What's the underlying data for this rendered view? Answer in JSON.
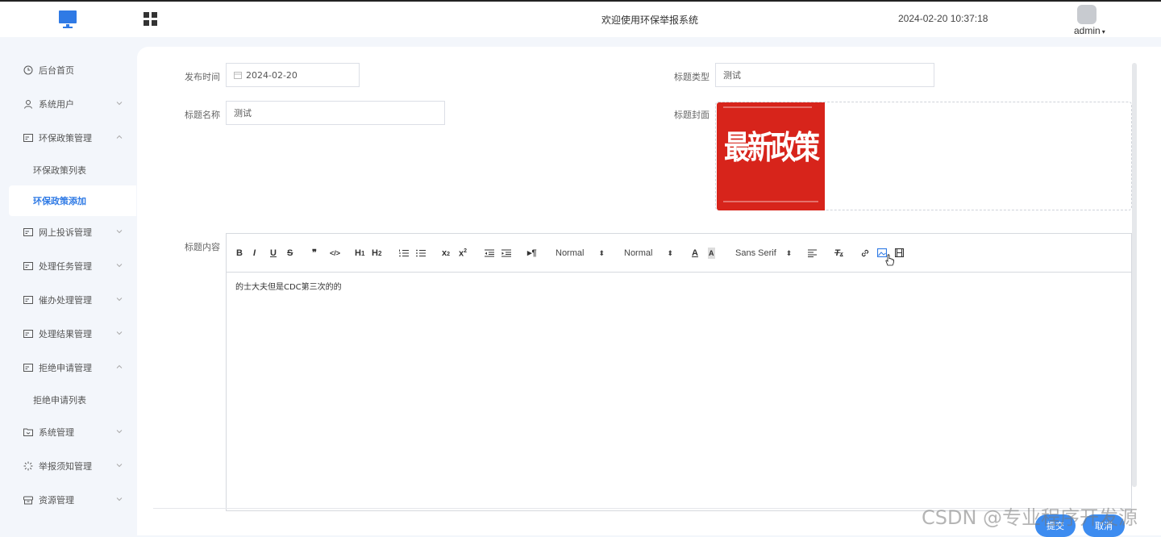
{
  "header": {
    "title": "欢迎使用环保举报系统",
    "datetime": "2024-02-20 10:37:18",
    "user": "admin"
  },
  "sidebar": {
    "items": [
      {
        "label": "后台首页",
        "icon": "clock-icon"
      },
      {
        "label": "系统用户",
        "icon": "user-icon",
        "chevron": "down"
      },
      {
        "label": "环保政策管理",
        "icon": "card-icon",
        "chevron": "up"
      },
      {
        "label": "环保政策列表"
      },
      {
        "label": "环保政策添加",
        "active": true
      },
      {
        "label": "网上投诉管理",
        "icon": "card-icon",
        "chevron": "down"
      },
      {
        "label": "处理任务管理",
        "icon": "card-icon",
        "chevron": "down"
      },
      {
        "label": "催办处理管理",
        "icon": "card-icon",
        "chevron": "down"
      },
      {
        "label": "处理结果管理",
        "icon": "card-icon",
        "chevron": "down"
      },
      {
        "label": "拒绝申请管理",
        "icon": "card-icon",
        "chevron": "up"
      },
      {
        "label": "拒绝申请列表"
      },
      {
        "label": "系统管理",
        "icon": "folder-icon",
        "chevron": "down"
      },
      {
        "label": "举报须知管理",
        "icon": "loading-icon",
        "chevron": "down"
      },
      {
        "label": "资源管理",
        "icon": "box-icon",
        "chevron": "down"
      }
    ]
  },
  "form": {
    "publish_time_label": "发布时间",
    "publish_time_value": "2024-02-20",
    "type_label": "标题类型",
    "type_value": "测试",
    "name_label": "标题名称",
    "name_value": "测试",
    "cover_label": "标题封面",
    "cover_text": "最新政策",
    "content_label": "标题内容",
    "content_value": "的士大夫但是CDC第三次的的"
  },
  "editor": {
    "size_select": "Normal",
    "header_select": "Normal",
    "font_select": "Sans Serif"
  },
  "buttons": {
    "submit": "提交",
    "cancel": "取消"
  },
  "watermark": "CSDN @专业程序开发源",
  "colors": {
    "accent": "#2f7ae5",
    "button": "#3d8cf0",
    "cover_red": "#d7241b"
  }
}
